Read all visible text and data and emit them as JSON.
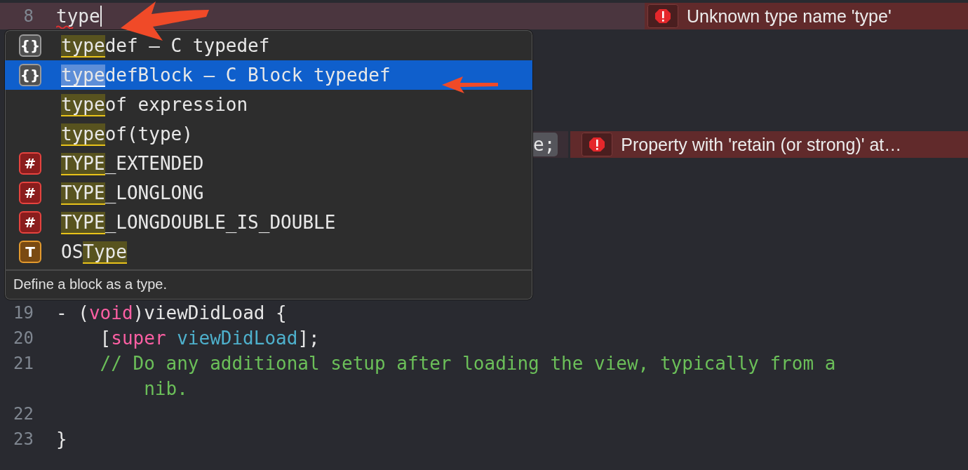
{
  "editor": {
    "error_line": {
      "number": "8",
      "segments": [
        {
          "text": "type",
          "kind": "plain"
        }
      ],
      "squiggle": true,
      "cursor": true,
      "message": "Unknown type name 'type'"
    },
    "completion": {
      "items": [
        {
          "icon": {
            "kind": "snippet",
            "glyph": "{}"
          },
          "selected": false,
          "parts": [
            {
              "text": "type",
              "match": true
            },
            {
              "text": "def – C typedef",
              "match": false
            }
          ]
        },
        {
          "icon": {
            "kind": "snippet",
            "glyph": "{}"
          },
          "selected": true,
          "parts": [
            {
              "text": "type",
              "match": true
            },
            {
              "text": "defBlock – C Block typedef",
              "match": false
            }
          ]
        },
        {
          "selected": false,
          "parts": [
            {
              "text": "type",
              "match": true
            },
            {
              "text": "of expression",
              "match": false
            }
          ]
        },
        {
          "selected": false,
          "parts": [
            {
              "text": "type",
              "match": true
            },
            {
              "text": "of(type)",
              "match": false
            }
          ]
        },
        {
          "icon": {
            "kind": "macro",
            "glyph": "#"
          },
          "selected": false,
          "parts": [
            {
              "text": "TYPE",
              "match": true
            },
            {
              "text": "_EXTENDED",
              "match": false
            }
          ]
        },
        {
          "icon": {
            "kind": "macro",
            "glyph": "#"
          },
          "selected": false,
          "parts": [
            {
              "text": "TYPE",
              "match": true
            },
            {
              "text": "_LONGLONG",
              "match": false
            }
          ]
        },
        {
          "icon": {
            "kind": "macro",
            "glyph": "#"
          },
          "selected": false,
          "parts": [
            {
              "text": "TYPE",
              "match": true
            },
            {
              "text": "_LONGDOUBLE_IS_DOUBLE",
              "match": false
            }
          ]
        },
        {
          "icon": {
            "kind": "type",
            "glyph": "T"
          },
          "selected": false,
          "parts": [
            {
              "text": "OS",
              "match": false
            },
            {
              "text": "Type",
              "match": true
            }
          ]
        }
      ],
      "description": "Define a block as a type."
    },
    "side_line": {
      "segments": [
        {
          "text": "e;",
          "kind": "plain"
        }
      ],
      "message": "Property with 'retain (or strong)' at…"
    },
    "lines": [
      {
        "number": "19",
        "segments": [
          {
            "text": "- (",
            "kind": "plain"
          },
          {
            "text": "void",
            "kind": "keyword"
          },
          {
            "text": ")viewDidLoad {",
            "kind": "plain"
          }
        ],
        "children": [
          {
            "number": "20",
            "segments": [
              {
                "text": "[",
                "kind": "plain"
              },
              {
                "text": "super",
                "kind": "keyword"
              },
              {
                "text": " viewDidLoad",
                "kind": "method"
              },
              {
                "text": "];",
                "kind": "plain"
              }
            ]
          },
          {
            "number": "21",
            "segments": [
              {
                "text": "// Do any additional setup after loading the view, typically from a",
                "kind": "comment"
              }
            ],
            "children": [
              {
                "segments": [
                  {
                    "text": "nib.",
                    "kind": "comment"
                  }
                ]
              }
            ]
          }
        ]
      },
      {
        "number": "22"
      },
      {
        "number": "23",
        "segments": [
          {
            "text": "}",
            "kind": "plain"
          }
        ]
      }
    ]
  }
}
